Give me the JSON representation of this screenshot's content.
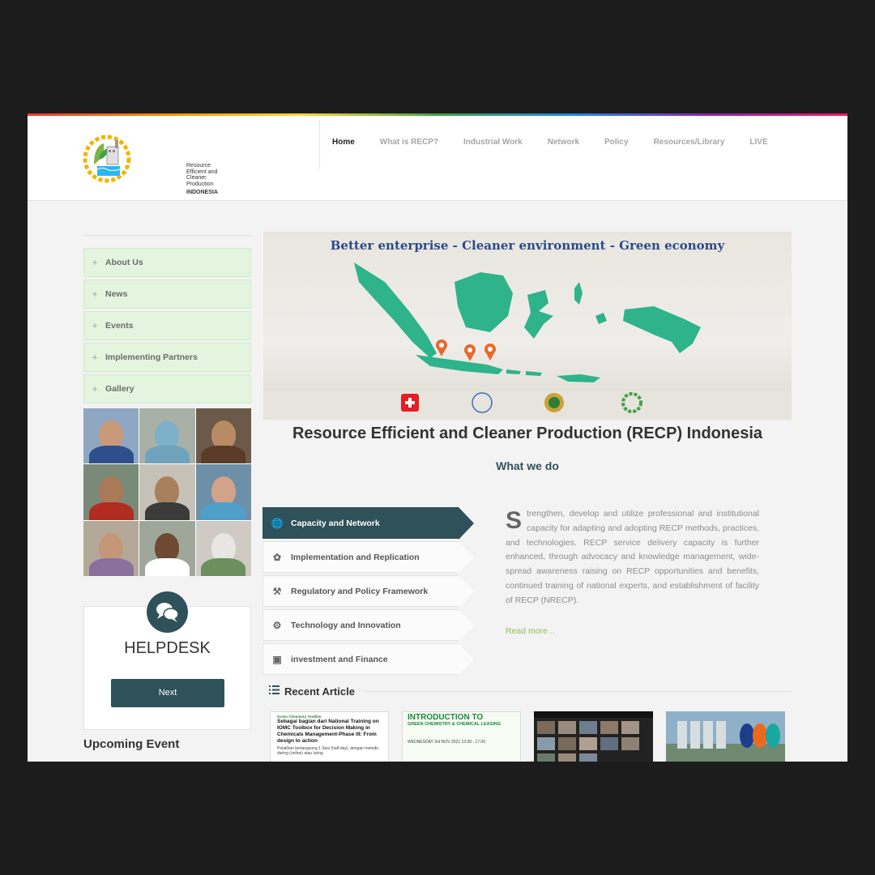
{
  "logo": {
    "lines": [
      "Resource",
      "Efficient and",
      "Cleaner",
      "Production"
    ],
    "country": "INDONESIA"
  },
  "nav": {
    "items": [
      "Home",
      "What is RECP?",
      "Industrial Work",
      "Network",
      "Policy",
      "Resources/Library",
      "LIVE"
    ]
  },
  "sidebar": {
    "items": [
      "About Us",
      "News",
      "Events",
      "Implementing Partners",
      "Gallery"
    ]
  },
  "helpdesk": {
    "title": "HELPDESK",
    "button": "Next"
  },
  "upcoming": {
    "title": "Upcoming Event"
  },
  "banner": {
    "title": "Better enterprise - Cleaner environment - Green economy"
  },
  "main": {
    "title": "Resource Efficient and Cleaner Production (RECP) Indonesia",
    "subtitle": "What we do"
  },
  "tabs": [
    {
      "label": "Capacity and Network",
      "icon": "globe-icon"
    },
    {
      "label": "Implementation and Replication",
      "icon": "leaf-icon"
    },
    {
      "label": "Regulatory and Policy Framework",
      "icon": "gavel-icon"
    },
    {
      "label": "Technology and Innovation",
      "icon": "gears-icon"
    },
    {
      "label": "investment and Finance",
      "icon": "briefcase-icon"
    }
  ],
  "tab_content": {
    "dropcap": "S",
    "text": "trengthen, develop and utilize professional and institutional capacity for adapting and adopting RECP methods, practices, and technologies. RECP service delivery capacity is further enhanced, through advocacy and knowledge management, wide-spread awareness raising on RECP opportunities and benefits, continued training of national experts, and establishment of facility of RECP (NRECP).",
    "read_more": "Read more .."
  },
  "recent": {
    "title": "Recent Article",
    "articles": [
      {
        "kicker": "Green Chemistry Toolkits",
        "title": "Sebagai bagian dari National Training on IOMC Toolbox for Decision Making in Chemicals Management-Phase III: From design to action",
        "sub": "Pelatihan berlangsung 1 Sesi (half-day), dengan metode daring (online) atau luring"
      },
      {
        "title": "INTRODUCTION TO",
        "sub": "GREEN CHEMISTRY & CHEMICAL LEASING",
        "date": "WEDNESDAY 3rd NOV 2021   13.00 - 17.00"
      },
      {},
      {}
    ]
  },
  "colors": {
    "accent": "#2f5159",
    "sidebar_bg": "#e3f5de",
    "map_green": "#2eb38a",
    "pin_orange": "#e8692b",
    "link_green": "#8bc34a"
  }
}
